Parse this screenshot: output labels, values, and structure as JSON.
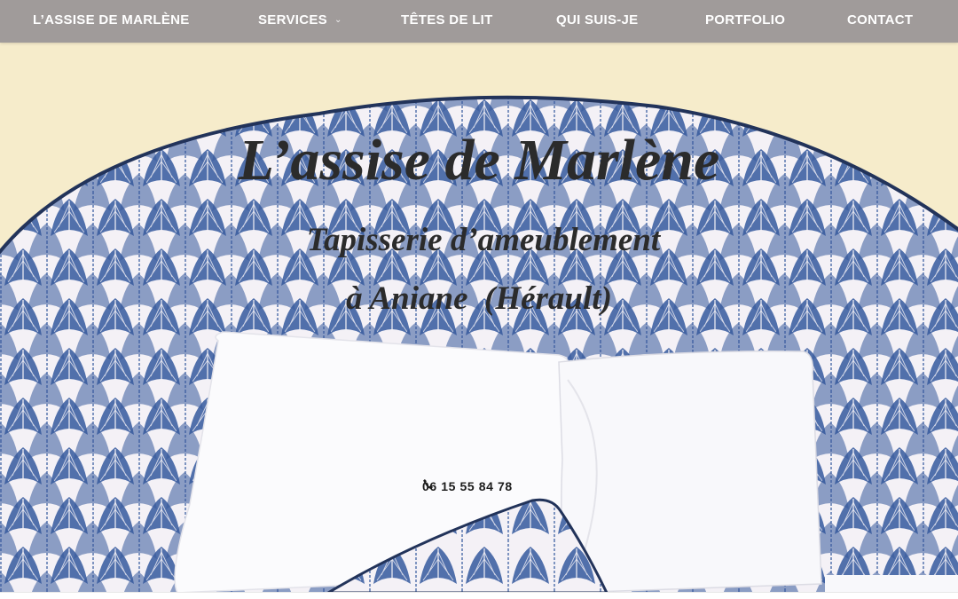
{
  "nav": {
    "items": [
      {
        "label": "L’ASSISE DE MARLÈNE"
      },
      {
        "label": "SERVICES",
        "has_submenu": true
      },
      {
        "label": "TÊTES DE LIT"
      },
      {
        "label": "QUI SUIS-JE"
      },
      {
        "label": "PORTFOLIO"
      },
      {
        "label": "CONTACT"
      }
    ],
    "chevron_glyph": "⌄"
  },
  "hero": {
    "title": "L’assise de Marlène",
    "subtitle_line1": "Tapisserie d’ameublement",
    "subtitle_line2": "à Aniane  (Hérault)",
    "phone": "06 15 55 84 78",
    "phone_icon": "phone-icon"
  },
  "colors": {
    "nav_bg": "#a09b9a",
    "nav_text": "#ffffff",
    "wall": "#f6eccb",
    "fabric_blue": "#3c5f9f",
    "headboard_edge": "#22335a",
    "title_text": "#2b2b2b"
  }
}
